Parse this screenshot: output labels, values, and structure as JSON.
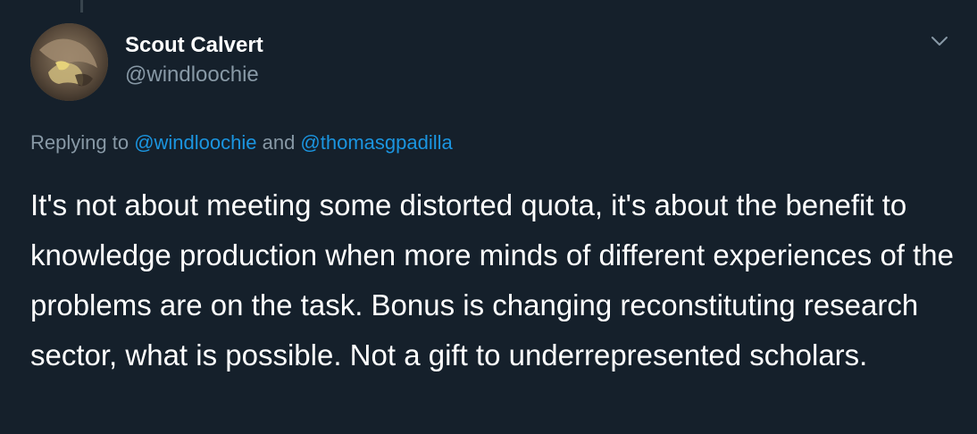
{
  "colors": {
    "background": "#15202b",
    "primary_text": "#ffffff",
    "secondary_text": "#8899a6",
    "link": "#1b95e0"
  },
  "user": {
    "display_name": "Scout Calvert",
    "handle": "@windloochie",
    "avatar_icon": "user-avatar"
  },
  "menu": {
    "icon": "chevron-down-icon"
  },
  "reply": {
    "prefix": "Replying to ",
    "mention_1": "@windloochie",
    "joiner": " and ",
    "mention_2": "@thomasgpadilla"
  },
  "tweet": {
    "text": "It's not about meeting some distorted quota, it's about the benefit to knowledge production when more minds of different experiences of the problems are on the task. Bonus is changing reconstituting research sector, what is possible. Not a gift to underrepresented scholars."
  }
}
